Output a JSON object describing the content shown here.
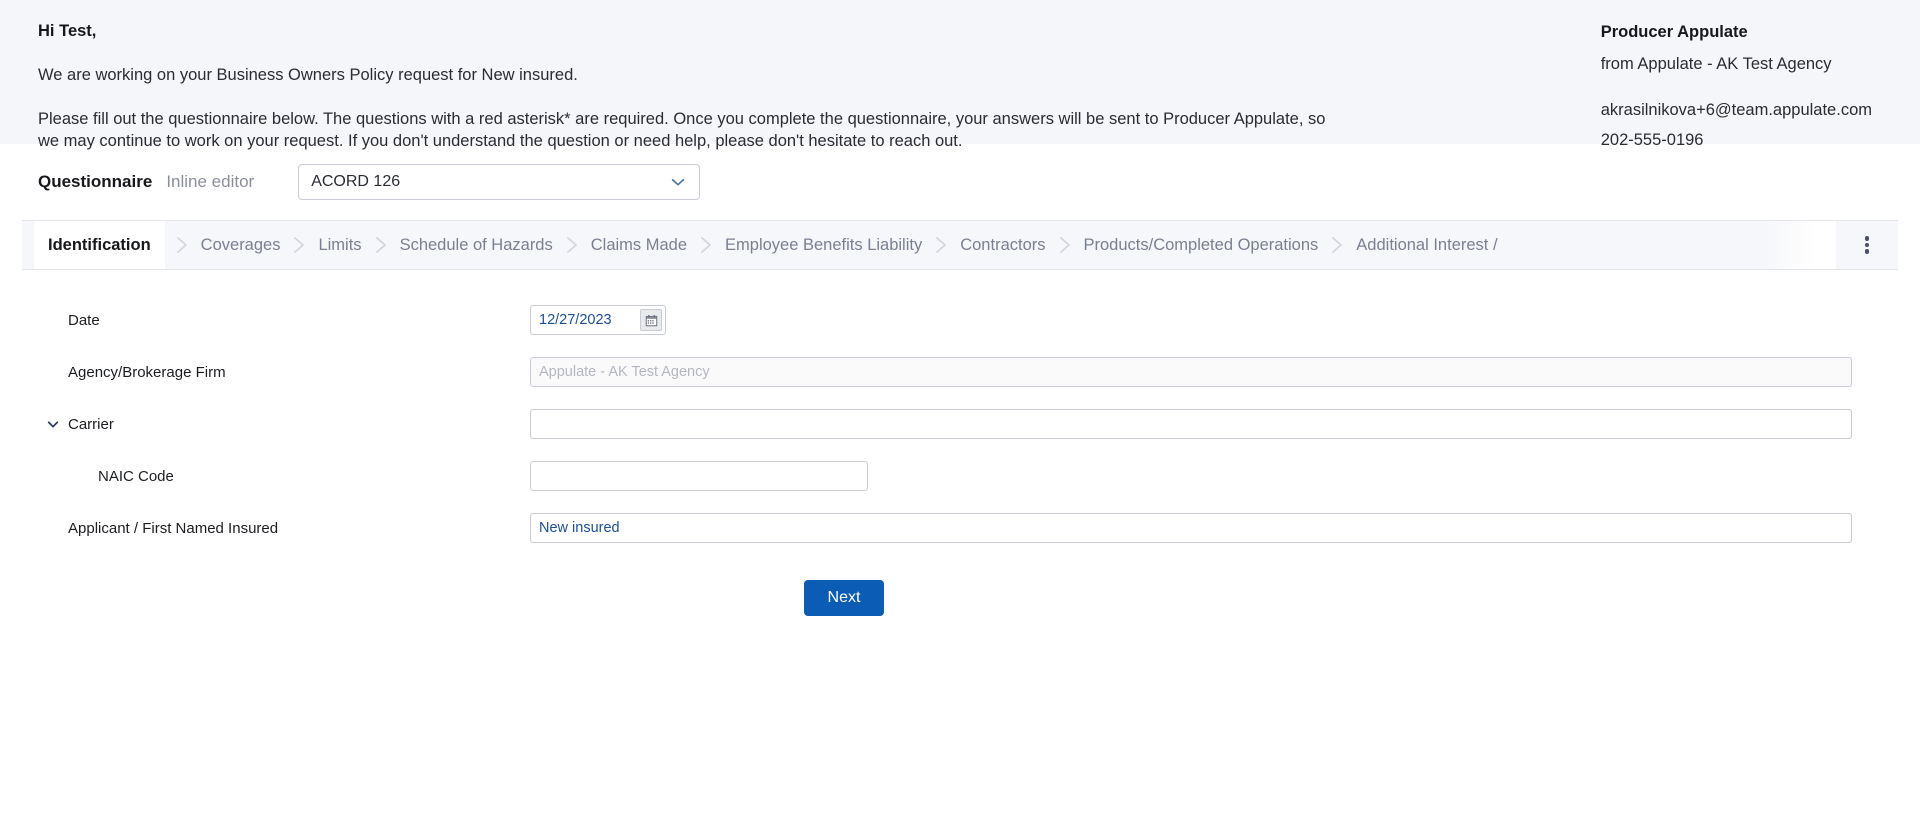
{
  "intro": {
    "greeting": "Hi Test,",
    "line1": "We are working on your Business Owners Policy request for New insured.",
    "line2": "Please fill out the questionnaire below. The questions with a red asterisk* are required. Once you complete the questionnaire, your answers will be sent to Producer Appulate, so we may continue to work on your request. If you don't understand the question or need help, please don't hesitate to reach out."
  },
  "producer": {
    "name": "Producer Appulate",
    "from": "from Appulate - AK Test Agency",
    "email": "akrasilnikova+6@team.appulate.com",
    "phone": "202-555-0196"
  },
  "questionnaire": {
    "title": "Questionnaire",
    "subtitle": "Inline editor",
    "form_selected": "ACORD 126",
    "form_options": [
      "ACORD 126"
    ],
    "select_icon": "chevron-down-icon",
    "more_icon": "kebab-menu-icon"
  },
  "tabs": [
    {
      "label": "Identification",
      "active": true
    },
    {
      "label": "Coverages",
      "active": false
    },
    {
      "label": "Limits",
      "active": false
    },
    {
      "label": "Schedule of Hazards",
      "active": false
    },
    {
      "label": "Claims Made",
      "active": false
    },
    {
      "label": "Employee Benefits Liability",
      "active": false
    },
    {
      "label": "Contractors",
      "active": false
    },
    {
      "label": "Products/Completed Operations",
      "active": false
    },
    {
      "label": "Additional Interest /",
      "active": false
    }
  ],
  "fields": {
    "date": {
      "label": "Date",
      "value": "12/27/2023",
      "calendar_icon": "calendar-icon"
    },
    "agency": {
      "label": "Agency/Brokerage Firm",
      "value": "",
      "placeholder": "Appulate - AK Test Agency"
    },
    "carrier": {
      "label": "Carrier",
      "value": "",
      "placeholder": "",
      "caret_icon": "chevron-down-icon"
    },
    "naic": {
      "label": "NAIC Code",
      "value": "",
      "placeholder": ""
    },
    "applicant": {
      "label": "Applicant / First Named Insured",
      "value": "New insured",
      "placeholder": ""
    }
  },
  "actions": {
    "next_label": "Next"
  },
  "colors": {
    "accent": "#0b5cb5",
    "band": "#f5f6fa",
    "tabstrip": "#f6f7fa",
    "value_text": "#1b4f9c",
    "muted": "#8b8f9c"
  }
}
